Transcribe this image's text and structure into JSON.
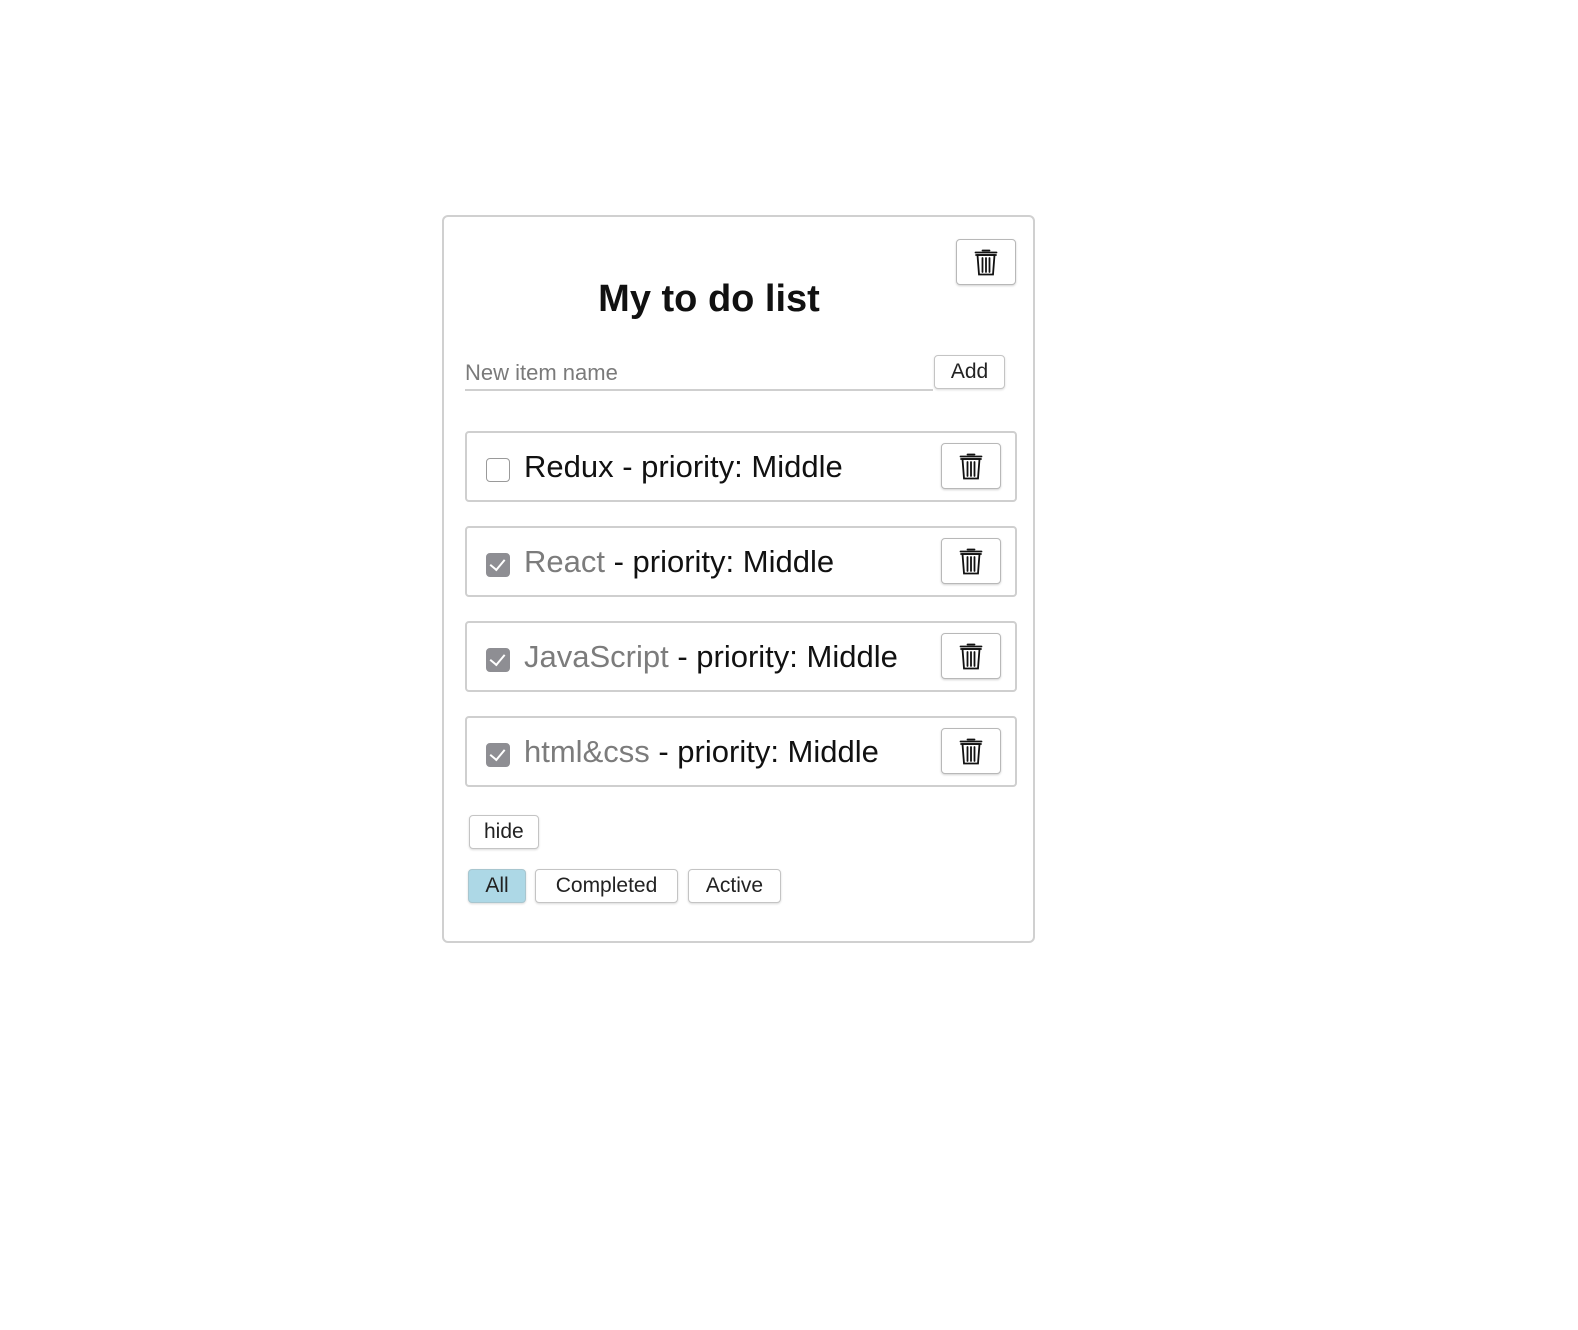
{
  "header": {
    "title": "My to do list",
    "clear_all_icon": "trash-icon"
  },
  "new_item": {
    "placeholder": "New item name",
    "value": "",
    "add_label": "Add"
  },
  "items": [
    {
      "name": "Redux",
      "separator": " - priority: ",
      "priority": "Middle",
      "completed": false
    },
    {
      "name": "React",
      "separator": " - priority: ",
      "priority": "Middle",
      "completed": true
    },
    {
      "name": "JavaScript",
      "separator": " - priority: ",
      "priority": "Middle",
      "completed": true
    },
    {
      "name": "html&css",
      "separator": " - priority: ",
      "priority": "Middle",
      "completed": true
    }
  ],
  "controls": {
    "hide_label": "hide"
  },
  "filters": {
    "options": [
      "All",
      "Completed",
      "Active"
    ],
    "selected": "All"
  },
  "colors": {
    "active_filter": "#add8e6",
    "checked_box": "#8e8e93",
    "completed_text": "#7c7c7c"
  }
}
